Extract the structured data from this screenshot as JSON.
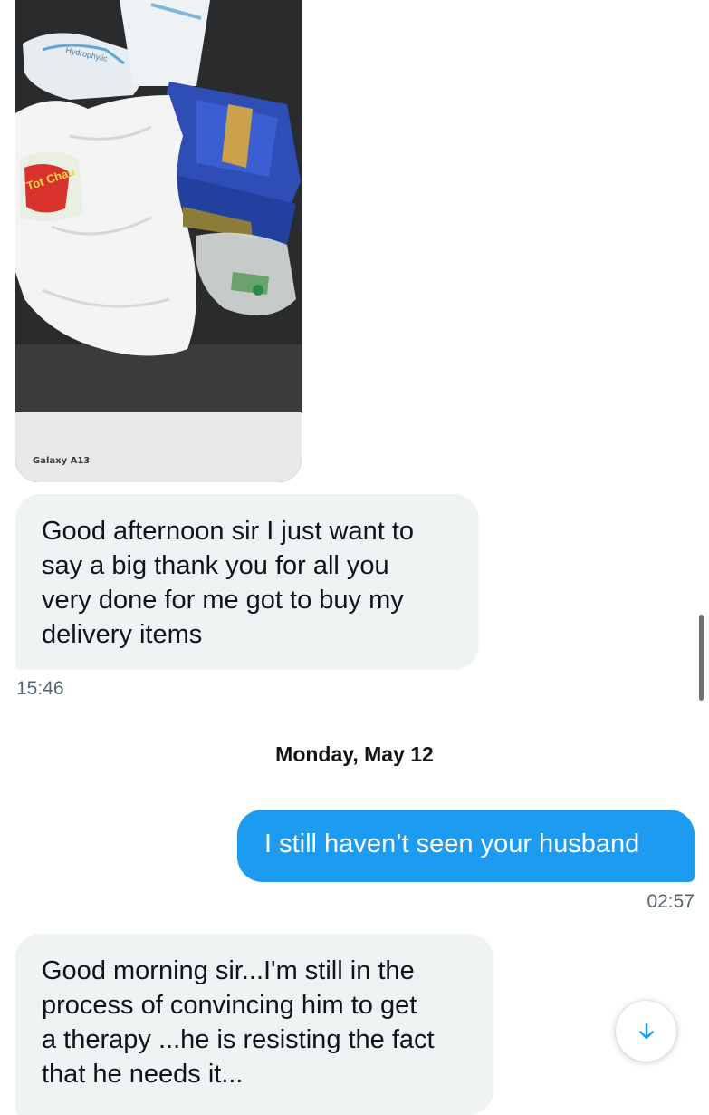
{
  "conversation": {
    "messages": [
      {
        "type": "image",
        "direction": "received",
        "device_label": "Galaxy A13",
        "image_text": {
          "package_label": "Hydrophylic",
          "bag_label": "Tot Chau"
        }
      },
      {
        "type": "text",
        "direction": "received",
        "text": "Good afternoon sir I just want to\nsay  a big thank you for all you\nvery done for me got to buy my\ndelivery items",
        "time": "15:46"
      },
      {
        "type": "divider",
        "text": "Monday, May 12"
      },
      {
        "type": "text",
        "direction": "sent",
        "text": "I still haven’t seen your husband",
        "time": "02:57"
      },
      {
        "type": "text",
        "direction": "received",
        "text": "Good morning sir...I'm still  in the\nprocess of convincing him to get\na therapy ...he is resisting the fact\nthat he needs it..."
      }
    ]
  },
  "controls": {
    "scroll_down_icon": "arrow-down-icon"
  },
  "colors": {
    "sent_bubble": "#1d9bf0",
    "received_bubble": "#eff3f4",
    "timestamp": "#536471",
    "text_primary": "#0f1419"
  }
}
